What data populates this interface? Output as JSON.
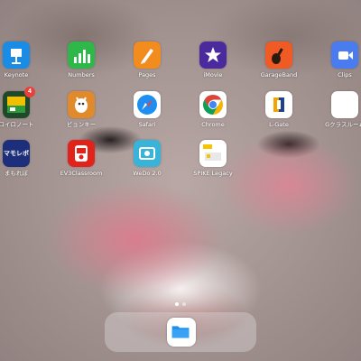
{
  "home": {
    "apps": [
      {
        "label": "Keynote",
        "icon": "keynote-icon"
      },
      {
        "label": "Numbers",
        "icon": "numbers-icon"
      },
      {
        "label": "Pages",
        "icon": "pages-icon"
      },
      {
        "label": "iMovie",
        "icon": "imovie-icon"
      },
      {
        "label": "GarageBand",
        "icon": "garageband-icon"
      },
      {
        "label": "Clips",
        "icon": "clips-icon"
      },
      {
        "label": "ロイロノート",
        "icon": "loilonote-icon",
        "badge": "4"
      },
      {
        "label": "ビョンキー",
        "icon": "viscuit-icon"
      },
      {
        "label": "Safari",
        "icon": "safari-icon"
      },
      {
        "label": "Chrome",
        "icon": "chrome-icon"
      },
      {
        "label": "L-Gate",
        "icon": "lgate-icon"
      },
      {
        "label": "Gクラスルーム",
        "icon": "google-classroom-icon"
      },
      {
        "label": "まもれぼ",
        "icon": "mamorebo-icon",
        "icon_text": "マモレボ"
      },
      {
        "label": "EV3Classroom",
        "icon": "ev3-classroom-icon"
      },
      {
        "label": "WeDo 2.0",
        "icon": "wedo-icon"
      },
      {
        "label": "SPIKE Legacy",
        "icon": "spike-legacy-icon"
      }
    ],
    "page_dots": {
      "count": 2,
      "current": 1
    }
  },
  "dock": {
    "apps": [
      {
        "icon": "files-icon"
      }
    ]
  },
  "colors": {
    "keynote": "#1a8ce6",
    "numbers": "#2fb84a",
    "pages": "#f28c1e",
    "imovie": "#4a2a9c",
    "garageband": "#f05a24",
    "clips": "#4a7cf0"
  }
}
